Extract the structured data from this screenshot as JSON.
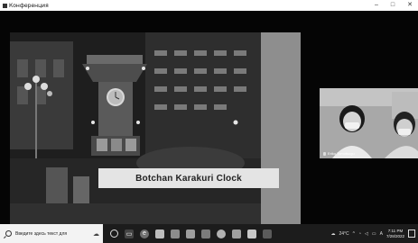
{
  "window": {
    "title": "Конференция",
    "controls": [
      "–",
      "□",
      "✕"
    ]
  },
  "slide": {
    "caption": "Botchan Karakuri Clock"
  },
  "participant": {
    "name": "Eriko Tomotsugu"
  },
  "taskbar": {
    "search_placeholder": "Введите здесь текст для",
    "apps": [
      "task-view",
      "edge",
      "explorer",
      "store",
      "mail",
      "office",
      "chrome",
      "photos",
      "app",
      "teams"
    ],
    "tray": {
      "temperature": "24°C",
      "language": "A",
      "time": "7:11 PM",
      "date": "7/28/2022"
    }
  }
}
